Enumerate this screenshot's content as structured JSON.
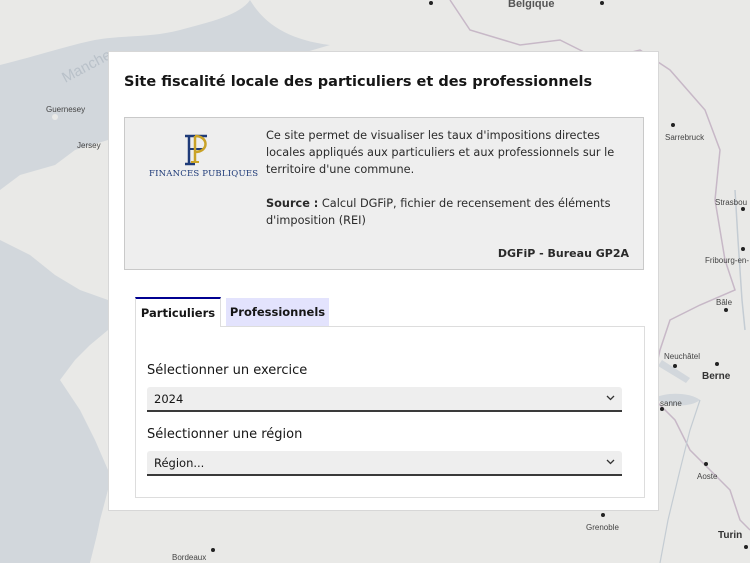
{
  "map": {
    "labels": {
      "manche": "Manche",
      "belgique": "Belgique",
      "guernesey": "Guernesey",
      "jersey": "Jersey",
      "sarrebruck": "Sarrebruck",
      "strasbourg": "Strasbou",
      "fribourg": "Fribourg-en-",
      "bale": "Bâle",
      "neuchatel": "Neuchâtel",
      "berne": "Berne",
      "lausanne": "sanne",
      "aoste": "Aoste",
      "grenoble": "Grenoble",
      "turin": "Turin",
      "bordeaux": "Bordeaux"
    },
    "colors": {
      "land": "#e9e9e7",
      "sea": "#d2d7dc"
    }
  },
  "panel": {
    "title": "Site fiscalité locale des particuliers et des professionnels",
    "info": {
      "logo_text": "FINANCES PUBLIQUES",
      "description": "Ce site permet de visualiser les taux d'impositions directes locales appliqués aux particuliers et aux professionnels sur le territoire d'une commune.",
      "source_label": "Source :",
      "source_text": " Calcul DGFiP, fichier de recensement des éléments d'imposition (REI)",
      "signature": "DGFiP - Bureau GP2A"
    },
    "tabs": [
      {
        "label": "Particuliers",
        "active": true
      },
      {
        "label": "Professionnels",
        "active": false
      }
    ],
    "form": {
      "exercice_label": "Sélectionner un exercice",
      "exercice_value": "2024",
      "region_label": "Sélectionner une région",
      "region_value": "Région..."
    },
    "colors": {
      "accent": "#000091",
      "tab_inactive": "#e3e3fd",
      "logo_gold": "#c9a227",
      "logo_blue": "#1e3a78"
    }
  }
}
